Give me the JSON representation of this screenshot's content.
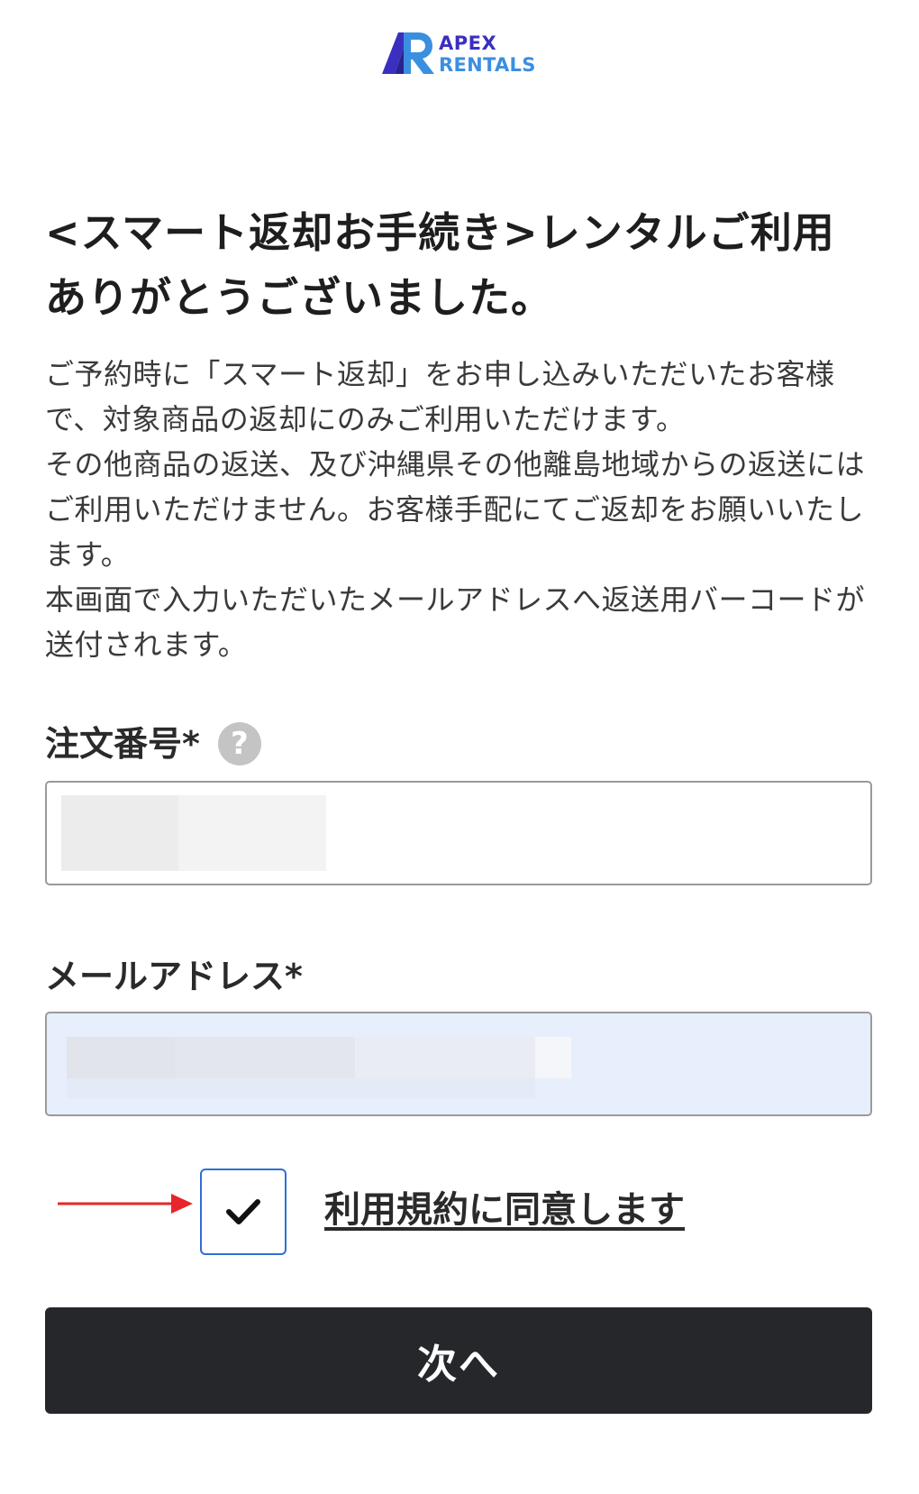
{
  "brand": {
    "line1": "APEX",
    "line2": "RENTALS",
    "colors": {
      "primary": "#3b2fbf",
      "secondary": "#3b8fe0"
    }
  },
  "page": {
    "title": "<スマート返却お手続き>レンタルご利用ありがとうございました。",
    "description": [
      "ご予約時に「スマート返却」をお申し込みいただいたお客様で、対象商品の返却にのみご利用いただけます。",
      "その他商品の返送、及び沖縄県その他離島地域からの返送にはご利用いただけません。お客様手配にてご返却をお願いいたします。",
      "本画面で入力いただいたメールアドレスへ返送用バーコードが送付されます。"
    ]
  },
  "form": {
    "order_number": {
      "label": "注文番号*",
      "help_icon": "question-icon"
    },
    "email": {
      "label": "メールアドレス*"
    },
    "agreement": {
      "checked": true,
      "label": "利用規約に同意します",
      "annotation_color": "#e8252a"
    },
    "next_label": "次へ"
  },
  "colors": {
    "button_bg": "#25272b",
    "checkbox_border": "#2f6fd6",
    "email_field_bg": "#e8effc"
  }
}
